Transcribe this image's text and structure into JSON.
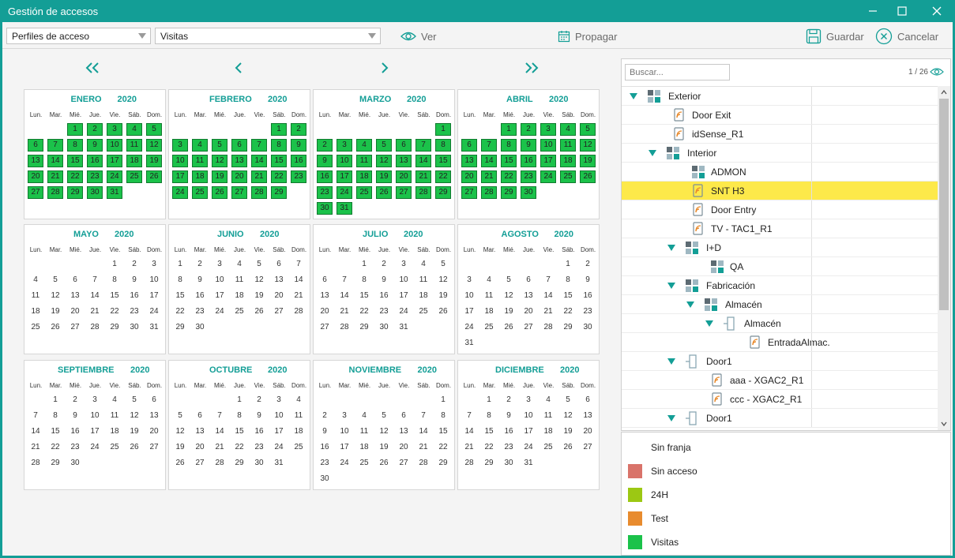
{
  "window": {
    "title": "Gestión de accesos"
  },
  "toolbar": {
    "profile_select": "Perfiles de acceso",
    "band_select": "Visitas",
    "view_label": "Ver",
    "propagate_label": "Propagar",
    "save_label": "Guardar",
    "cancel_label": "Cancelar"
  },
  "calendar": {
    "year": "2020",
    "weekdays": [
      "Lun.",
      "Mar.",
      "Mié.",
      "Jue.",
      "Vie.",
      "Sáb.",
      "Dom."
    ],
    "colors": {
      "green": "#1bc24a",
      "accent": "#139e96"
    },
    "months": [
      {
        "name": "ENERO",
        "start": 2,
        "days": 31,
        "green": true
      },
      {
        "name": "FEBRERO",
        "start": 5,
        "days": 29,
        "green": true
      },
      {
        "name": "MARZO",
        "start": 6,
        "days": 31,
        "green": true
      },
      {
        "name": "ABRIL",
        "start": 2,
        "days": 30,
        "green": true
      },
      {
        "name": "MAYO",
        "start": 4,
        "days": 31,
        "green": false
      },
      {
        "name": "JUNIO",
        "start": 0,
        "days": 30,
        "green": false
      },
      {
        "name": "JULIO",
        "start": 2,
        "days": 31,
        "green": false
      },
      {
        "name": "AGOSTO",
        "start": 5,
        "days": 31,
        "green": false
      },
      {
        "name": "SEPTIEMBRE",
        "start": 1,
        "days": 30,
        "green": false
      },
      {
        "name": "OCTUBRE",
        "start": 3,
        "days": 31,
        "green": false
      },
      {
        "name": "NOVIEMBRE",
        "start": 6,
        "days": 30,
        "green": false
      },
      {
        "name": "DICIEMBRE",
        "start": 1,
        "days": 31,
        "green": false
      }
    ]
  },
  "tree": {
    "search_placeholder": "Buscar...",
    "counter": "1 / 26",
    "items": [
      {
        "label": "Exterior",
        "level": 0,
        "icon": "group-icon",
        "expanded": true,
        "selected": false
      },
      {
        "label": "Door Exit",
        "level": 1,
        "icon": "reader-icon",
        "expanded": false,
        "selected": false
      },
      {
        "label": "idSense_R1",
        "level": 1,
        "icon": "reader-icon",
        "expanded": false,
        "selected": false
      },
      {
        "label": "Interior",
        "level": 1,
        "icon": "group-icon",
        "expanded": true,
        "selected": false
      },
      {
        "label": "ADMON",
        "level": 2,
        "icon": "group-icon",
        "expanded": false,
        "selected": false
      },
      {
        "label": "SNT H3",
        "level": 2,
        "icon": "reader-icon",
        "expanded": false,
        "selected": true
      },
      {
        "label": "Door Entry",
        "level": 2,
        "icon": "reader-icon",
        "expanded": false,
        "selected": false
      },
      {
        "label": "TV - TAC1_R1",
        "level": 2,
        "icon": "reader-icon",
        "expanded": false,
        "selected": false
      },
      {
        "label": "I+D",
        "level": 2,
        "icon": "group-icon",
        "expanded": true,
        "selected": false
      },
      {
        "label": "QA",
        "level": 3,
        "icon": "group-icon",
        "expanded": false,
        "selected": false
      },
      {
        "label": "Fabricación",
        "level": 2,
        "icon": "group-icon",
        "expanded": true,
        "selected": false
      },
      {
        "label": "Almacén",
        "level": 3,
        "icon": "group-icon",
        "expanded": true,
        "selected": false
      },
      {
        "label": "Almacén",
        "level": 4,
        "icon": "door-icon",
        "expanded": true,
        "selected": false
      },
      {
        "label": "EntradaAlmac.",
        "level": 5,
        "icon": "reader-icon",
        "expanded": false,
        "selected": false
      },
      {
        "label": "Door1",
        "level": 2,
        "icon": "door-icon",
        "expanded": true,
        "selected": false
      },
      {
        "label": "aaa - XGAC2_R1",
        "level": 3,
        "icon": "reader-icon",
        "expanded": false,
        "selected": false
      },
      {
        "label": "ccc - XGAC2_R1",
        "level": 3,
        "icon": "reader-icon",
        "expanded": false,
        "selected": false
      },
      {
        "label": "Door1",
        "level": 2,
        "icon": "door-icon",
        "expanded": true,
        "selected": false
      }
    ]
  },
  "legend": {
    "items": [
      {
        "label": "Sin franja",
        "color": ""
      },
      {
        "label": "Sin acceso",
        "color": "#d9736a"
      },
      {
        "label": "24H",
        "color": "#9cc813"
      },
      {
        "label": "Test",
        "color": "#e88b2e"
      },
      {
        "label": "Visitas",
        "color": "#1bc24a"
      }
    ]
  }
}
